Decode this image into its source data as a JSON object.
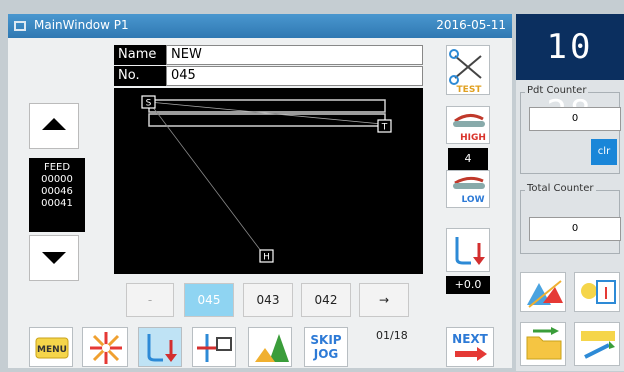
{
  "titlebar": {
    "title": "MainWindow P1",
    "date": "2016-05-11"
  },
  "clock": {
    "time": "10 28"
  },
  "pattern": {
    "name_label": "Name",
    "name_value": "NEW",
    "no_label": "No.",
    "no_value": "045"
  },
  "feed": {
    "title": "FEED",
    "lines": [
      "00000",
      "00046",
      "00041"
    ]
  },
  "markers": {
    "start": "S",
    "turn": "T",
    "home": "H"
  },
  "tension": {
    "high_label": "HIGH",
    "value": "4",
    "low_label": "LOW",
    "test_label": "TEST"
  },
  "offset": {
    "value": "+0.0"
  },
  "pager": {
    "items": [
      "-",
      "045",
      "043",
      "042",
      "→"
    ],
    "page_indicator": "01/18"
  },
  "toolbar": {
    "menu_label": "MENU",
    "skip_label": "SKIP",
    "jog_label": "JOG",
    "next_label": "NEXT"
  },
  "counters": {
    "pdt_title": "Pdt Counter",
    "pdt_value": "0",
    "clr_label": "clr",
    "total_title": "Total Counter",
    "total_value": "0"
  }
}
